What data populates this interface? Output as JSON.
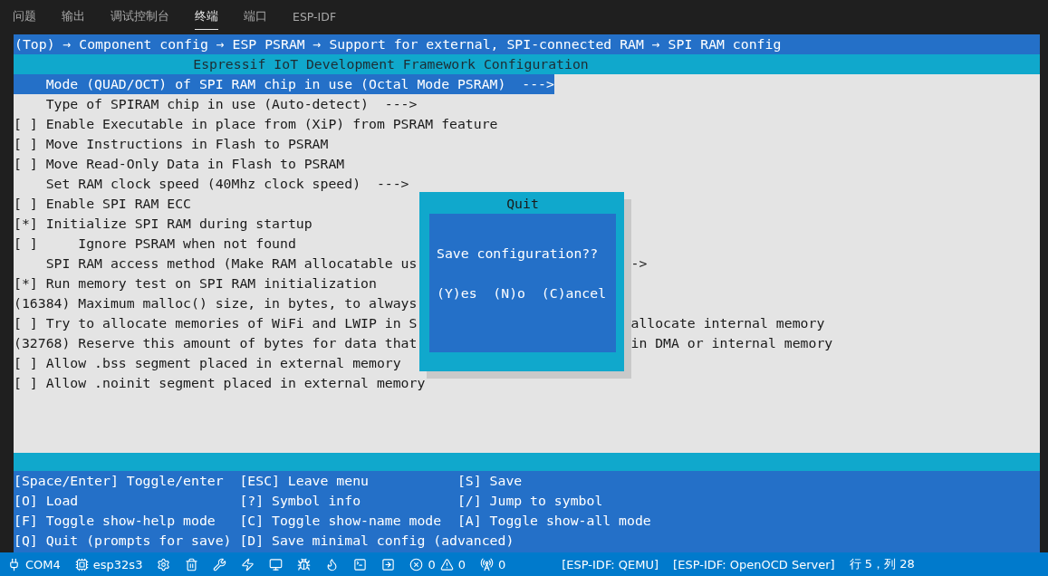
{
  "tabs": [
    {
      "label": "问题",
      "selected": false
    },
    {
      "label": "输出",
      "selected": false
    },
    {
      "label": "调试控制台",
      "selected": false
    },
    {
      "label": "终端",
      "selected": true
    },
    {
      "label": "端口",
      "selected": false
    },
    {
      "label": "ESP-IDF",
      "selected": false
    }
  ],
  "terminal": {
    "breadcrumb": "(Top) → Component config → ESP PSRAM → Support for external, SPI-connected RAM → SPI RAM config",
    "title": "Espressif IoT Development Framework Configuration",
    "lines": [
      {
        "text": "    Mode (QUAD/OCT) of SPI RAM chip in use (Octal Mode PSRAM)  --->",
        "selected": true
      },
      {
        "text": "    Type of SPIRAM chip in use (Auto-detect)  --->",
        "selected": false
      },
      {
        "text": "[ ] Enable Executable in place from (XiP) from PSRAM feature",
        "selected": false
      },
      {
        "text": "[ ] Move Instructions in Flash to PSRAM",
        "selected": false
      },
      {
        "text": "[ ] Move Read-Only Data in Flash to PSRAM",
        "selected": false
      },
      {
        "text": "    Set RAM clock speed (40Mhz clock speed)  --->",
        "selected": false
      },
      {
        "text": "[ ] Enable SPI RAM ECC",
        "selected": false
      },
      {
        "text": "[*] Initialize SPI RAM during startup",
        "selected": false
      },
      {
        "text": "[ ]     Ignore PSRAM when not found",
        "selected": false
      },
      {
        "text": "    SPI RAM access method (Make RAM allocatable us",
        "tail": "->",
        "selected": false
      },
      {
        "text": "[*] Run memory test on SPI RAM initialization",
        "selected": false
      },
      {
        "text": "(16384) Maximum malloc() size, in bytes, to always",
        "selected": false
      },
      {
        "text": "[ ] Try to allocate memories of WiFi and LWIP in S",
        "tail": "allocate internal memory",
        "selected": false
      },
      {
        "text": "(32768) Reserve this amount of bytes for data that",
        "tail": "in DMA or internal memory",
        "selected": false
      },
      {
        "text": "[ ] Allow .bss segment placed in external memory",
        "selected": false
      },
      {
        "text": "[ ] Allow .noinit segment placed in external memory",
        "selected": false
      }
    ],
    "dialog": {
      "title": "Quit",
      "message": "Save configuration??",
      "options": "(Y)es  (N)o  (C)ancel"
    },
    "help": [
      "[Space/Enter] Toggle/enter",
      "[ESC] Leave menu",
      "[S] Save",
      "[O] Load",
      "[?] Symbol info",
      "[/] Jump to symbol",
      "[F] Toggle show-help mode",
      "[C] Toggle show-name mode",
      "[A] Toggle show-all mode",
      "[Q] Quit (prompts for save)",
      "[D] Save minimal config (advanced)"
    ]
  },
  "status_bar": {
    "port": "COM4",
    "target": "esp32s3",
    "errors": "0",
    "warnings": "0",
    "ports_count": "0",
    "qemu": "[ESP-IDF: QEMU]",
    "openocd": "[ESP-IDF: OpenOCD Server]",
    "position": "行 5，列 28"
  }
}
